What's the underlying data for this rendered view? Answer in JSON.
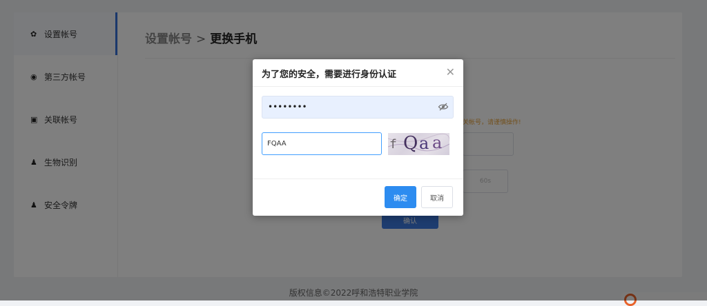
{
  "sidebar": {
    "items": [
      {
        "icon": "gear-icon",
        "glyph": "✿",
        "label": "设置帐号",
        "active": true
      },
      {
        "icon": "third-party-icon",
        "glyph": "◉",
        "label": "第三方帐号"
      },
      {
        "icon": "link-icon",
        "glyph": "▣",
        "label": "关联帐号"
      },
      {
        "icon": "biometric-icon",
        "glyph": "♟",
        "label": "生物识别"
      },
      {
        "icon": "token-icon",
        "glyph": "♟",
        "label": "安全令牌"
      }
    ]
  },
  "header": {
    "breadcrumb_parent": "设置帐号",
    "breadcrumb_sep": ">",
    "breadcrumb_current": "更换手机"
  },
  "background_form": {
    "warning": "关帐号，请谨慎操作!",
    "code_countdown": "60s",
    "confirm_label": "确认"
  },
  "dialog": {
    "title": "为了您的安全，需要进行身份认证",
    "close_glyph": "✕",
    "password_value": "••••••••",
    "captcha_value": "FQAA",
    "captcha_chars": [
      "f",
      "Q",
      "a",
      "a"
    ],
    "ok_label": "确定",
    "cancel_label": "取消"
  },
  "footer": {
    "copyright": "版权信息©2022呼和浩特职业学院"
  },
  "colors": {
    "accent": "#2d8cf0",
    "active_bar": "#3571d9",
    "warning": "#e6a23c"
  }
}
